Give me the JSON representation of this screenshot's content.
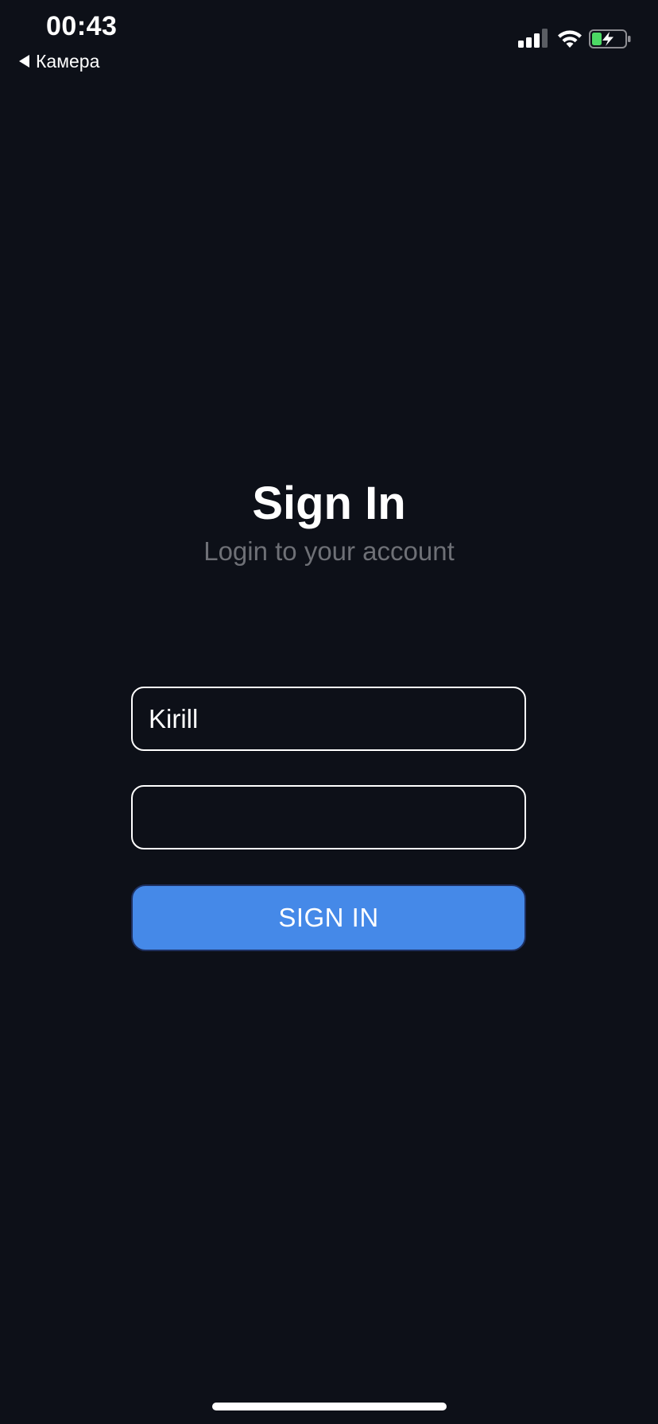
{
  "status_bar": {
    "time": "00:43",
    "back_app_label": "Камера",
    "signal_icon": "cellular-signal-icon",
    "signal_bars_filled": 3,
    "signal_bars_total": 4,
    "wifi_icon": "wifi-icon",
    "battery_icon": "battery-charging-icon",
    "battery_level": 0.3,
    "battery_color": "#4cd964"
  },
  "login": {
    "title": "Sign In",
    "subtitle": "Login to your account",
    "username_value": "Kirill",
    "password_value": "",
    "sign_in_label": "SIGN IN"
  },
  "colors": {
    "background": "#0d1018",
    "accent": "#4589e8",
    "muted_text": "#6e7076"
  }
}
